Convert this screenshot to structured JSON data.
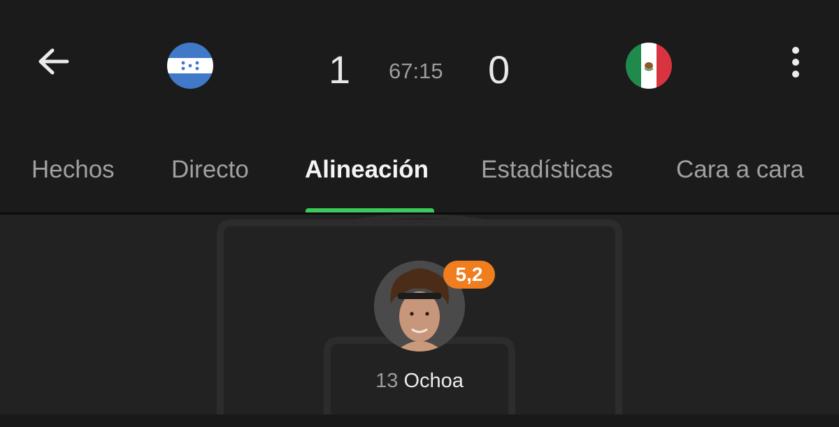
{
  "match": {
    "home_score": "1",
    "away_score": "0",
    "time": "67:15"
  },
  "home_team": {
    "flag": "honduras-flag"
  },
  "away_team": {
    "flag": "mexico-flag"
  },
  "tabs": [
    {
      "label": "Hechos"
    },
    {
      "label": "Directo"
    },
    {
      "label": "Alineación",
      "active": true
    },
    {
      "label": "Estadísticas"
    },
    {
      "label": "Cara a cara"
    }
  ],
  "lineup": {
    "players": [
      {
        "number": "13",
        "name": "Ochoa",
        "rating": "5,2"
      }
    ]
  },
  "colors": {
    "background": "#1b1b1b",
    "accent": "#3ccb5a",
    "rating_badge": "#f07d1e"
  }
}
